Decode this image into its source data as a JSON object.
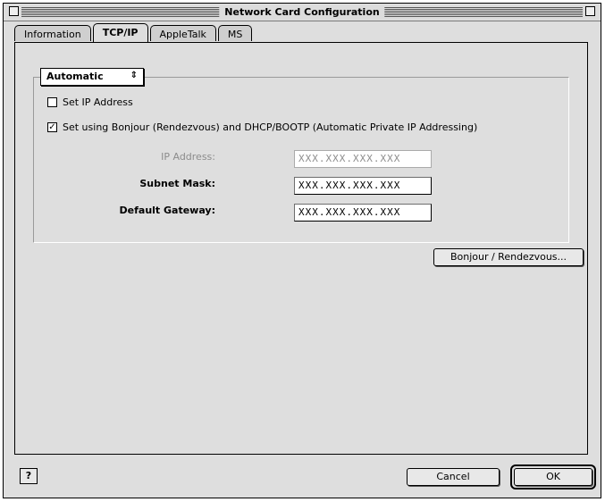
{
  "window": {
    "title": "Network Card Configuration"
  },
  "tabs": [
    {
      "label": "Information"
    },
    {
      "label": "TCP/IP"
    },
    {
      "label": "AppleTalk"
    },
    {
      "label": "MS"
    }
  ],
  "tcpip": {
    "method_select": {
      "value": "Automatic"
    },
    "checkboxes": [
      {
        "label": "Set IP Address",
        "checked": false
      },
      {
        "label": "Set using Bonjour (Rendezvous) and DHCP/BOOTP (Automatic Private IP Addressing)",
        "checked": true
      }
    ],
    "fields": [
      {
        "label": "IP Address:",
        "value": "XXX.XXX.XXX.XXX",
        "enabled": false
      },
      {
        "label": "Subnet Mask:",
        "value": "XXX.XXX.XXX.XXX",
        "enabled": true
      },
      {
        "label": "Default Gateway:",
        "value": "XXX.XXX.XXX.XXX",
        "enabled": true
      }
    ],
    "advanced_button": {
      "label": "Bonjour / Rendezvous..."
    }
  },
  "footer": {
    "help_label": "?",
    "cancel_label": "Cancel",
    "ok_label": "OK"
  }
}
